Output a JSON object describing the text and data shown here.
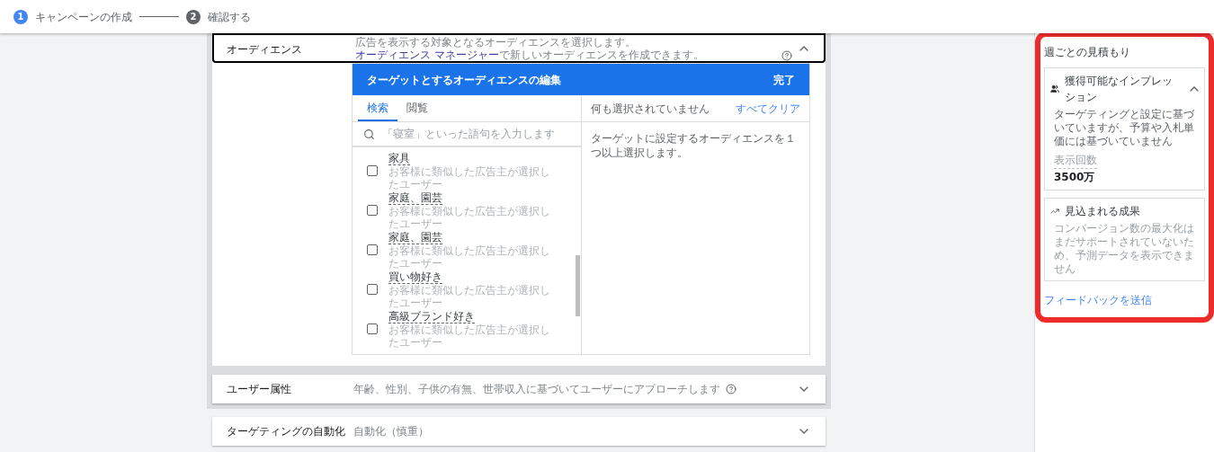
{
  "steps": [
    {
      "number": "1",
      "label": "キャンペーンの作成",
      "selected": true
    },
    {
      "number": "2",
      "label": "確認する",
      "selected": false
    }
  ],
  "audience": {
    "label": "オーディエンス",
    "description_before": "広告を表示する対象となるオーディエンスを選択します。",
    "link": "オーディエンス マネージャー",
    "description_after": "で新しいオーディエンスを作成できます。",
    "expanded": true,
    "editor": {
      "title": "ターゲットとするオーディエンスの編集",
      "done": "完了",
      "tabs": [
        {
          "label": "検索",
          "selected": true
        },
        {
          "label": "閲覧",
          "selected": false
        }
      ],
      "search": {
        "placeholder": "「寝室」といった語句を入力します"
      },
      "items": [
        {
          "name": "家具",
          "description": "お客様に類似した広告主が選択したユーザー",
          "checked": false
        },
        {
          "name": "家庭、園芸",
          "description": "お客様に類似した広告主が選択したユーザー",
          "checked": false
        },
        {
          "name": "家庭、園芸",
          "description": "お客様に類似した広告主が選択したユーザー",
          "checked": false
        },
        {
          "name": "買い物好き",
          "description": "お客様に類似した広告主が選択したユーザー",
          "checked": false
        },
        {
          "name": "高級ブランド好き",
          "description": "お客様に類似した広告主が選択したユーザー",
          "checked": false
        }
      ],
      "selection_status": "何も選択されていません",
      "clear_all": "すべてクリア",
      "hint": "ターゲットに設定するオーディエンスを１つ以上選択します。"
    }
  },
  "sections": [
    {
      "label": "ユーザー属性",
      "description": "年齢、性別、子供の有無、世帯収入に基づいてユーザーにアプローチします",
      "help": true,
      "expanded": false
    },
    {
      "label": "ターゲティングの自動化",
      "description": "自動化（慎重）",
      "help": false,
      "expanded": false
    }
  ],
  "estimates": {
    "title": "週ごとの見積もり",
    "cards": [
      {
        "kind": "impressions",
        "title": "獲得可能なインプレッション",
        "expanded": true,
        "description": "ターゲティングと設定に基づいていますが、予算や入札単価には基づいていません",
        "metric_label": "表示回数",
        "metric_value": "3500万"
      },
      {
        "kind": "conversions",
        "title": "見込まれる成果",
        "description": "コンバージョン数の最大化はまだサポートされていないため、予測データを表示できません"
      }
    ],
    "feedback": "フィードバックを送信"
  }
}
